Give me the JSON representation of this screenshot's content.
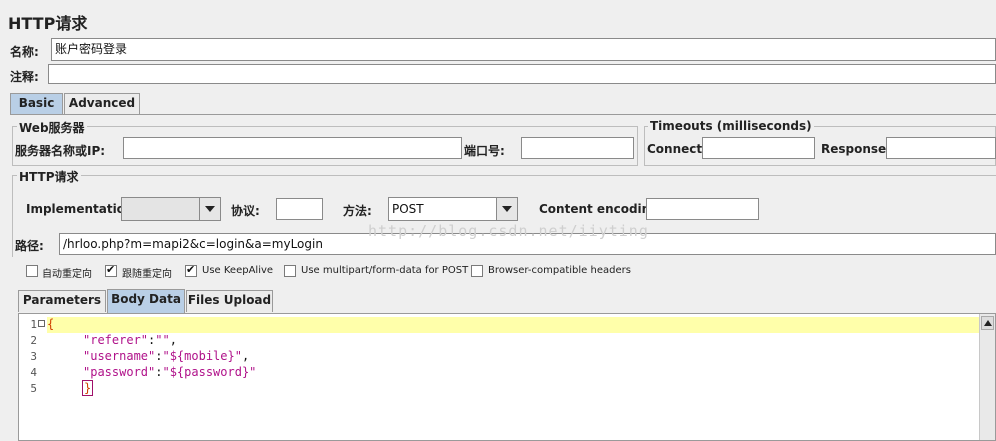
{
  "panel": {
    "title": "HTTP请求",
    "name_label": "名称:",
    "name_value": "账户密码登录",
    "comment_label": "注释:",
    "comment_value": ""
  },
  "tabs": [
    {
      "label": "Basic",
      "active": true
    },
    {
      "label": "Advanced",
      "active": false
    }
  ],
  "web_server": {
    "legend": "Web服务器",
    "server_label": "服务器名称或IP:",
    "server_value": "",
    "port_label": "端口号:",
    "port_value": ""
  },
  "timeouts": {
    "legend": "Timeouts (milliseconds)",
    "connect_label": "Connect:",
    "connect_value": "",
    "response_label": "Response:",
    "response_value": ""
  },
  "http_request": {
    "legend": "HTTP请求",
    "implementation_label": "Implementation:",
    "implementation_value": "",
    "protocol_label": "协议:",
    "protocol_value": "",
    "method_label": "方法:",
    "method_value": "POST",
    "encoding_label": "Content encoding:",
    "encoding_value": "",
    "path_label": "路径:",
    "path_value": "/hrloo.php?m=mapi2&c=login&a=myLogin"
  },
  "options": [
    {
      "label": "自动重定向",
      "checked": false
    },
    {
      "label": "跟随重定向",
      "checked": true
    },
    {
      "label": "Use KeepAlive",
      "checked": true
    },
    {
      "label": "Use multipart/form-data for POST",
      "checked": false
    },
    {
      "label": "Browser-compatible headers",
      "checked": false
    }
  ],
  "sub_tabs": [
    {
      "label": "Parameters",
      "active": false
    },
    {
      "label": "Body Data",
      "active": true
    },
    {
      "label": "Files Upload",
      "active": false
    }
  ],
  "body_editor": {
    "lines": [
      {
        "num": "1",
        "text": "{"
      },
      {
        "num": "2",
        "key": "\"referer\"",
        "sep": ":",
        "val": "\"\"",
        "end": ","
      },
      {
        "num": "3",
        "key": "\"username\"",
        "sep": ":",
        "val": "\"${mobile}\"",
        "end": ","
      },
      {
        "num": "4",
        "key": "\"password\"",
        "sep": ":",
        "val": "\"${password}\"",
        "end": ""
      },
      {
        "num": "5",
        "text": "}"
      }
    ]
  },
  "watermark": "http://blog.csdn.net/iiyting"
}
